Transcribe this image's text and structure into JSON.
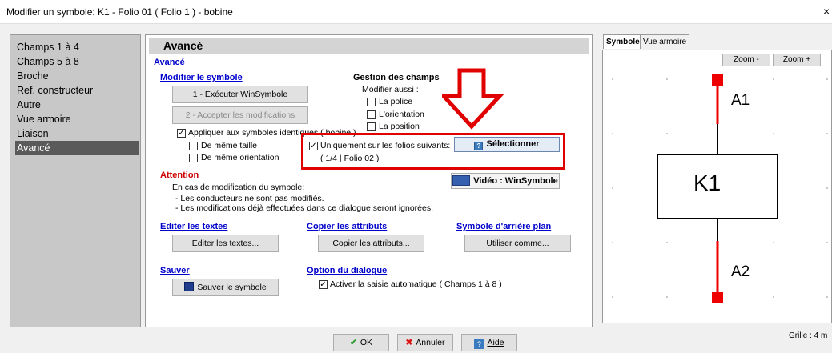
{
  "window": {
    "title": "Modifier un symbole: K1 - Folio 01 ( Folio 1 ) - bobine",
    "close": "×"
  },
  "nav": {
    "items": [
      "Champs 1 à 4",
      "Champs 5 à 8",
      "Broche",
      "Ref. constructeur",
      "Autre",
      "Vue armoire",
      "Liaison",
      "Avancé"
    ],
    "selected": "Avancé"
  },
  "main": {
    "header": "Avancé",
    "section_link": "Avancé",
    "modifier": {
      "title": "Modifier le symbole",
      "btn_exec": "1 - Exécuter WinSymbole",
      "btn_accept": "2 - Accepter les modifications",
      "apply_label": "Appliquer aux symboles identiques ( bobine )",
      "same_size": "De même taille",
      "same_orient": "De même orientation"
    },
    "gestion": {
      "title": "Gestion des champs",
      "sub": "Modifier aussi :",
      "police": "La police",
      "orientation": "L'orientation",
      "position": "La position"
    },
    "folios": {
      "label": "Uniquement sur les folios suivants:",
      "info": "( 1/4  |  Folio 02 )",
      "btn_select": "Sélectionner"
    },
    "video_btn": "Vidéo : WinSymbole",
    "attention": {
      "title": "Attention",
      "line1": "En cas de modification du symbole:",
      "line2": "- Les conducteurs ne sont pas modifiés.",
      "line3": "- Les modifications déjà effectuées dans ce dialogue seront ignorées."
    },
    "editer": {
      "title": "Editer les textes",
      "btn": "Editer les textes..."
    },
    "copier": {
      "title": "Copier les attributs",
      "btn": "Copier les attributs..."
    },
    "arriere": {
      "title": "Symbole d'arrière plan",
      "btn": "Utiliser comme..."
    },
    "sauver": {
      "title": "Sauver",
      "btn": "Sauver le symbole"
    },
    "option": {
      "title": "Option du dialogue",
      "auto_label": "Activer la saisie automatique ( Champs 1 à 8 )"
    }
  },
  "preview": {
    "tab_symbol": "Symbole",
    "tab_armoire": "Vue armoire",
    "zoom_out": "Zoom -",
    "zoom_in": "Zoom +",
    "symbol_label": "K1",
    "pin_top": "A1",
    "pin_bottom": "A2",
    "grid_text": "Grille : 4 m"
  },
  "footer": {
    "ok": "OK",
    "cancel": "Annuler",
    "help": "Aide"
  },
  "colors": {
    "accent_red": "#e00000",
    "link_blue": "#0000cc",
    "nav_selected": "#5a5a5a"
  }
}
